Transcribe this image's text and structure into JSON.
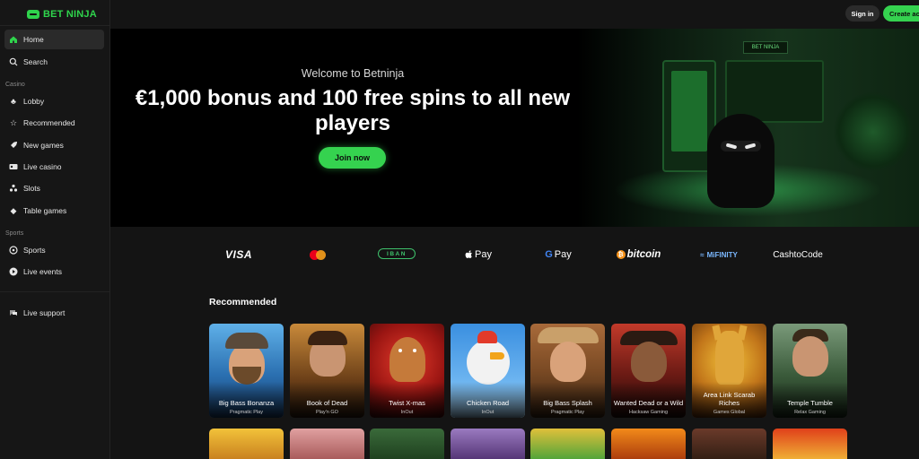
{
  "brand": {
    "name": "BET NINJA"
  },
  "topbar": {
    "signin_label": "Sign in",
    "create_label": "Create account"
  },
  "sidebar": {
    "main": [
      {
        "label": "Home",
        "icon": "home-icon"
      },
      {
        "label": "Search",
        "icon": "search-icon"
      }
    ],
    "casino_label": "Casino",
    "casino": [
      {
        "label": "Lobby",
        "icon": "clubs-icon"
      },
      {
        "label": "Recommended",
        "icon": "star-icon"
      },
      {
        "label": "New games",
        "icon": "rocket-icon"
      },
      {
        "label": "Live casino",
        "icon": "live-casino-icon"
      },
      {
        "label": "Slots",
        "icon": "slots-icon"
      },
      {
        "label": "Table games",
        "icon": "diamond-icon"
      }
    ],
    "sports_label": "Sports",
    "sports": [
      {
        "label": "Sports",
        "icon": "ball-icon"
      },
      {
        "label": "Live events",
        "icon": "play-icon"
      }
    ],
    "support": {
      "label": "Live support",
      "icon": "chat-icon"
    }
  },
  "hero": {
    "welcome": "Welcome to Betninja",
    "title": "€1,000 bonus and 100 free spins to all new players",
    "cta_label": "Join now",
    "shelf_sign": "BET NINJA"
  },
  "payments": {
    "visa": "VISA",
    "iban": "IBAN",
    "applepay": "Pay",
    "gpay": "Pay",
    "bitcoin": "bitcoin",
    "mifinity": "MiFINITY",
    "cashtocode": "CashtoCode"
  },
  "recommended": {
    "title": "Recommended",
    "games": [
      {
        "name": "Big Bass Bonanza",
        "provider": "Pragmatic Play"
      },
      {
        "name": "Book of Dead",
        "provider": "Play'n GO"
      },
      {
        "name": "Twist X-mas",
        "provider": "InOut"
      },
      {
        "name": "Chicken Road",
        "provider": "InOut"
      },
      {
        "name": "Big Bass Splash",
        "provider": "Pragmatic Play"
      },
      {
        "name": "Wanted Dead or a Wild",
        "provider": "Hacksaw Gaming"
      },
      {
        "name": "Area Link Scarab Riches",
        "provider": "Games Global"
      },
      {
        "name": "Temple Tumble",
        "provider": "Relax Gaming"
      }
    ]
  },
  "colors": {
    "accent": "#35d24f",
    "background": "#141414",
    "sidebar": "#161616"
  }
}
